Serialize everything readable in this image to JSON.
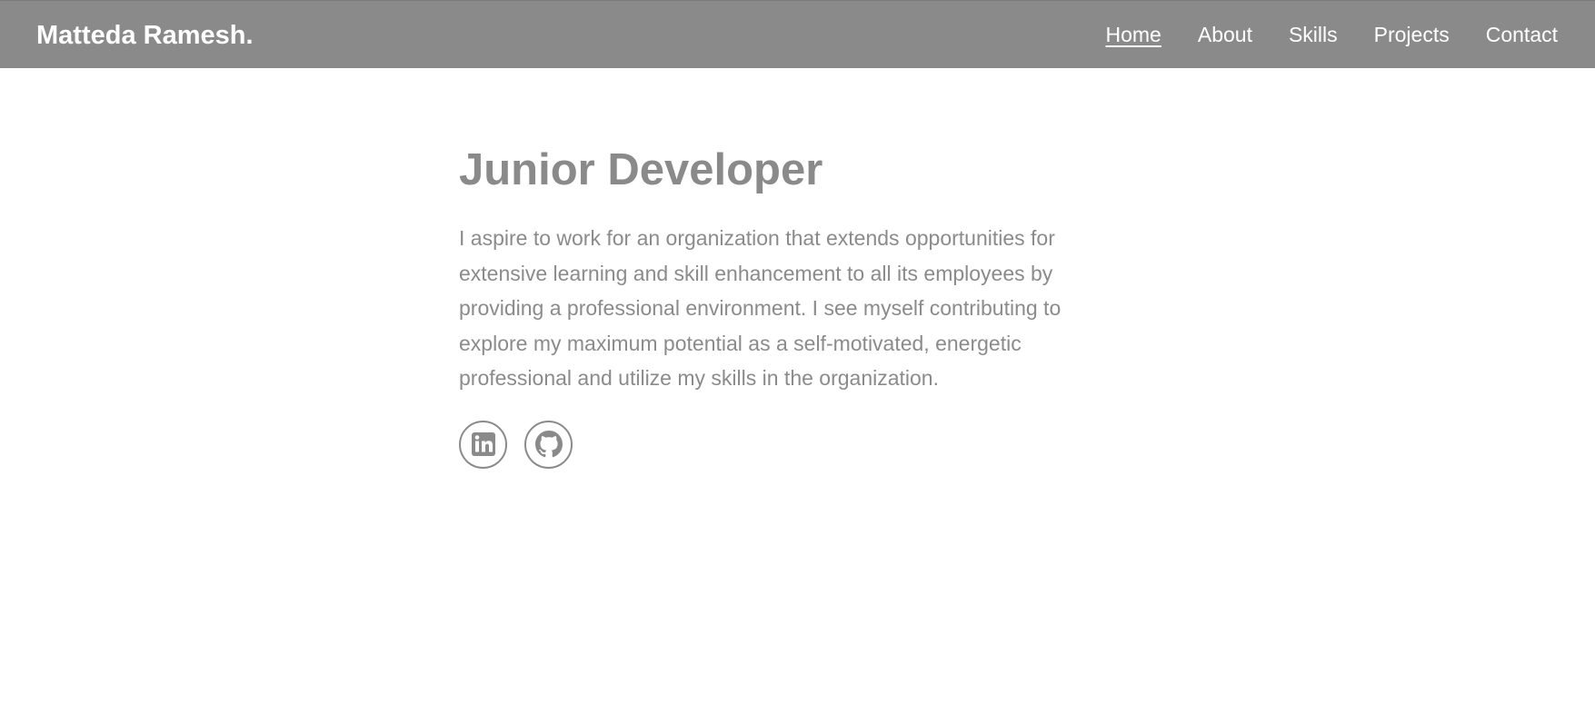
{
  "header": {
    "brand": "Matteda Ramesh.",
    "nav": [
      {
        "label": "Home",
        "active": true
      },
      {
        "label": "About"
      },
      {
        "label": "Skills"
      },
      {
        "label": "Projects"
      },
      {
        "label": "Contact"
      }
    ]
  },
  "hero": {
    "title": "Junior Developer",
    "description": "I aspire to work for an organization that extends opportunities for extensive learning and skill enhancement to all its employees by providing a professional environment. I see myself contributing to explore my maximum potential as a self-motivated, energetic professional and utilize my skills in the organization.",
    "socials": [
      {
        "icon": "linkedin-icon"
      },
      {
        "icon": "github-icon"
      }
    ]
  },
  "colors": {
    "navbar_bg": "#898a89",
    "text_gray": "#898a89",
    "white": "#ffffff"
  }
}
